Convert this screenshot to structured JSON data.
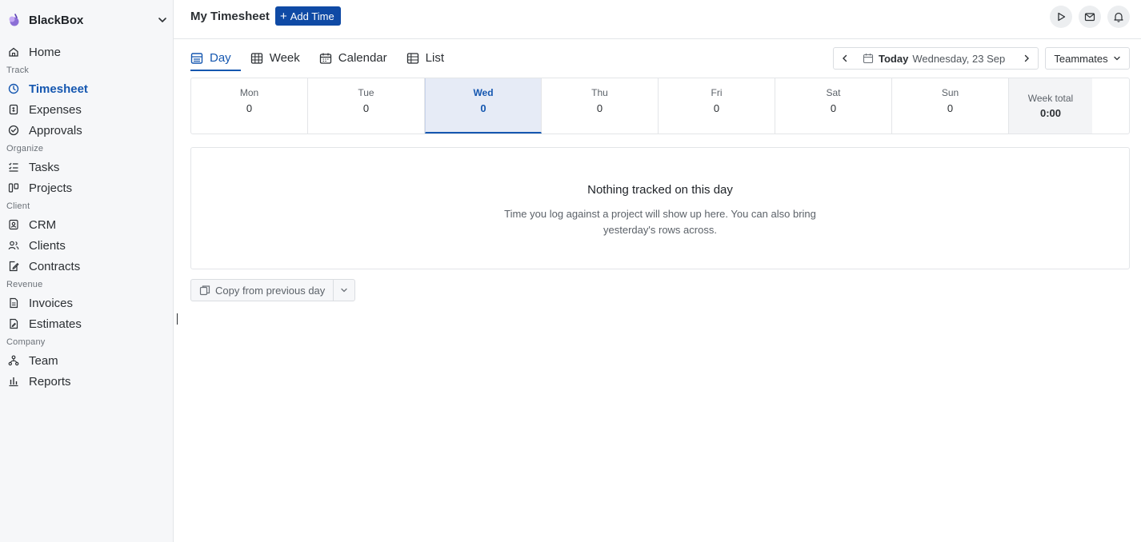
{
  "app": {
    "name": "BlackBox"
  },
  "sidebar": {
    "home": "Home",
    "sections": {
      "track": "Track",
      "organize": "Organize",
      "client": "Client",
      "revenue": "Revenue",
      "company": "Company"
    },
    "items": {
      "timesheet": "Timesheet",
      "expenses": "Expenses",
      "approvals": "Approvals",
      "tasks": "Tasks",
      "projects": "Projects",
      "crm": "CRM",
      "clients": "Clients",
      "contracts": "Contracts",
      "invoices": "Invoices",
      "estimates": "Estimates",
      "team": "Team",
      "reports": "Reports"
    },
    "active_item": "Timesheet"
  },
  "header": {
    "title": "My Timesheet",
    "add_button": "Add Time",
    "accent": "#0f4aa5"
  },
  "tabs": [
    {
      "label": "Day",
      "icon": "day-view-icon",
      "active": true
    },
    {
      "label": "Week",
      "icon": "week-grid-icon",
      "active": false
    },
    {
      "label": "Calendar",
      "icon": "calendar-icon",
      "active": false
    },
    {
      "label": "List",
      "icon": "list-table-icon",
      "active": false
    }
  ],
  "date_nav": {
    "today": "Today",
    "date": "Wednesday, 23 Sep"
  },
  "teammates": "Teammates",
  "week": {
    "days": [
      {
        "name": "Mon",
        "value": "0"
      },
      {
        "name": "Tue",
        "value": "0"
      },
      {
        "name": "Wed",
        "value": "0",
        "active": true
      },
      {
        "name": "Thu",
        "value": "0"
      },
      {
        "name": "Fri",
        "value": "0"
      },
      {
        "name": "Sat",
        "value": "0"
      },
      {
        "name": "Sun",
        "value": "0"
      }
    ],
    "total_label": "Week total",
    "total_value": "0:00"
  },
  "empty_state": {
    "heading": "Nothing tracked on this day",
    "body": "Time you log against a project will show up here. You can also bring yesterday's rows across."
  },
  "copy_button": "Copy from previous day"
}
